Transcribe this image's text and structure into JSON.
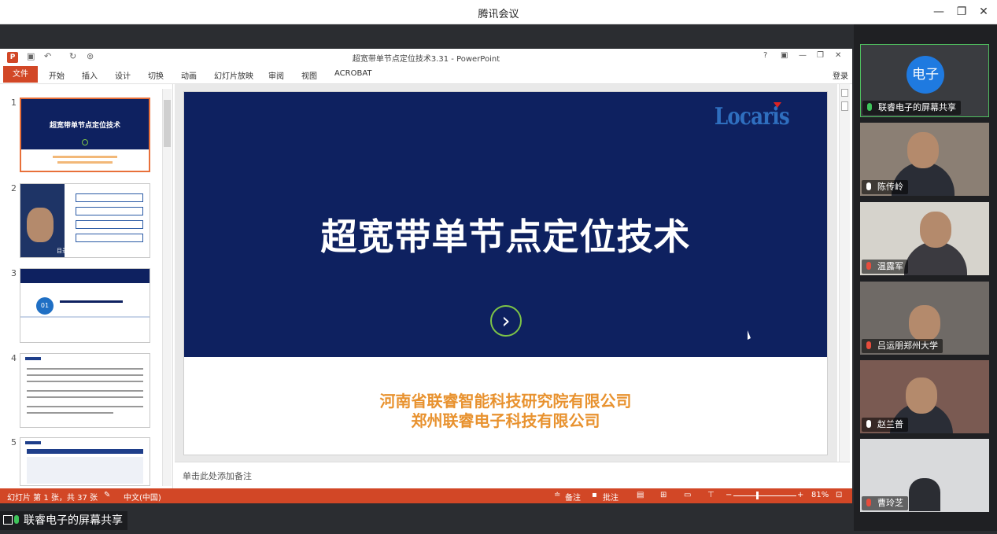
{
  "window": {
    "title": "腾讯会议"
  },
  "ppt": {
    "title": "超宽带单节点定位技术3.31 - PowerPoint",
    "qa_icons": [
      "save-icon",
      "undo-icon",
      "redo-icon",
      "present-icon"
    ],
    "window_controls": [
      "?",
      "—",
      "✕"
    ],
    "ribbon": {
      "file": "文件",
      "tabs": [
        "开始",
        "插入",
        "设计",
        "切换",
        "动画",
        "幻灯片放映",
        "审阅",
        "视图",
        "ACROBAT"
      ],
      "login": "登录"
    },
    "thumbnails": [
      {
        "num": "1",
        "title": "超宽带单节点定位技术"
      },
      {
        "num": "2",
        "title": "目录"
      },
      {
        "num": "3",
        "title": "01"
      },
      {
        "num": "4",
        "title": ""
      },
      {
        "num": "5",
        "title": ""
      }
    ],
    "slide": {
      "logo": "Locaris",
      "title": "超宽带单节点定位技术",
      "company_1": "河南省联睿智能科技研究院有限公司",
      "company_2": "郑州联睿电子科技有限公司"
    },
    "notes_placeholder": "单击此处添加备注",
    "status": {
      "slide_info": "幻灯片 第 1 张，共 37 张",
      "language": "中文(中国)",
      "notes": "备注",
      "comments": "批注",
      "zoom": "81%"
    }
  },
  "participants": [
    {
      "name": "联睿电子的屏幕共享",
      "avatar": "电子",
      "active": true
    },
    {
      "name": "陈传岭"
    },
    {
      "name": "温露军"
    },
    {
      "name": "吕运朋郑州大学"
    },
    {
      "name": "赵兰普"
    },
    {
      "name": "曹玲芝"
    }
  ],
  "share_label": "联睿电子的屏幕共享",
  "colors": {
    "ppt_accent": "#d24726",
    "slide_bg": "#0e2160",
    "company_text": "#e8922f",
    "active_border": "#4fbf5f"
  }
}
